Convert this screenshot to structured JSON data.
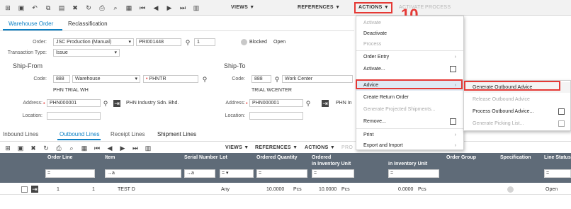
{
  "toolbar": {
    "menus": [
      "VIEWS",
      "REFERENCES",
      "ACTIONS",
      "ACTIVATE",
      "PROCESS"
    ],
    "actions_label": "ACTIONS ▼",
    "views_label": "VIEWS ▼",
    "references_label": "REFERENCES ▼",
    "activate_label": "ACTIVATE",
    "process_label": "PROCESS"
  },
  "tabs": [
    "Warehouse Order",
    "Reclassification"
  ],
  "form": {
    "order_label": "Order:",
    "order_type": "JSC Production (Manual)",
    "order_number": "PRI001448",
    "order_seq": "1",
    "blocked_label": "Blocked",
    "status": "Open",
    "transaction_type_label": "Transaction Type:",
    "transaction_type": "Issue",
    "ship_from": "Ship-From",
    "ship_to": "Ship-To",
    "code_label": "Code:",
    "from_code": "888",
    "from_type": "Warehouse",
    "from_wh": "PHNTR",
    "from_name": "PHN TRIAL WH",
    "address_label": "Address:",
    "from_address": "PHN000001",
    "from_company": "PHN Industry Sdn. Bhd.",
    "location_label": "Location:",
    "to_code": "888",
    "to_type": "Work Center",
    "to_name": "TRIAL WCENTER",
    "to_address": "PHN000001",
    "to_company": "PHN In"
  },
  "lower_tabs": [
    "Inbound Lines",
    "Outbound Lines",
    "Receipt Lines",
    "Shipment Lines"
  ],
  "grid": {
    "views_label": "VIEWS ▼",
    "references_label": "REFERENCES ▼",
    "actions_label": "ACTIONS ▼",
    "pro_label": "PRO",
    "headers": {
      "order_line": "Order Line",
      "item": "Item",
      "serial_number": "Serial Number",
      "lot": "Lot",
      "ordered_quantity": "Ordered Quantity",
      "ordered_inv": "Ordered",
      "ordered_inv2": "in Inventory Unit",
      "shipped_inv": "in Inventory Unit",
      "order_group": "Order Group",
      "specification": "Specification",
      "line_status": "Line Status"
    },
    "row": {
      "line": "1",
      "seq": "1",
      "item": "TEST D",
      "lot": "Any",
      "ordered_qty": "10.0000",
      "ordered_unit": "Pcs",
      "inv_qty": "10.0000",
      "inv_unit": "Pcs",
      "shipped_qty": "0.0000",
      "shipped_unit": "Pcs",
      "status": "Open"
    }
  },
  "actions_menu": {
    "items": [
      "Activate",
      "Deactivate",
      "Process",
      "Order Entry",
      "Activate...",
      "Advice",
      "Create Return Order",
      "Generate Projected Shipments...",
      "Remove...",
      "Print",
      "Export and Import"
    ]
  },
  "advice_submenu": {
    "items": [
      "Generate Outbound Advice",
      "Release Outbound Advice",
      "Process Outbound Advice...",
      "Generate Picking List..."
    ]
  },
  "step_number": "10",
  "colors": {
    "accent": "#0a7fc4",
    "highlight": "#e53935",
    "grid_header": "#5f6b78"
  }
}
